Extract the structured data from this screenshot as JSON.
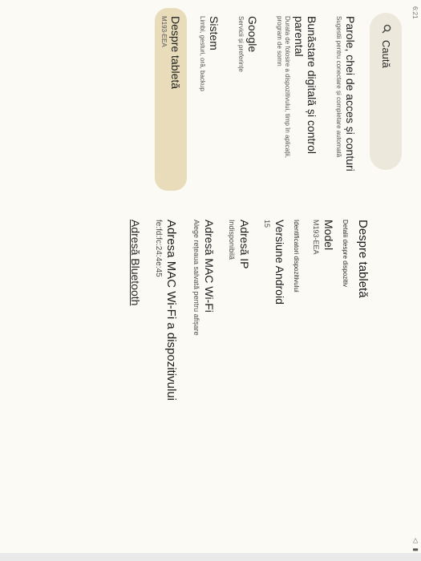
{
  "status": {
    "clock": "6:21",
    "icons": "◁ ▮"
  },
  "search": {
    "label": "Caută"
  },
  "sidebar": {
    "items": [
      {
        "title": "Parole, chei de acces și conturi",
        "subtitle": "Sugestii pentru conectare și completare automată"
      },
      {
        "title": "Bunăstare digitală și control parental",
        "subtitle": "Durata de folosire a dispozitivului, timp în aplicații, program de somn"
      },
      {
        "title": "Google",
        "subtitle": "Servicii și preferințe"
      },
      {
        "title": "Sistem",
        "subtitle": "Limbi, gesturi, oră, backup"
      },
      {
        "title": "Despre tabletă",
        "subtitle": "M193-EEA"
      }
    ]
  },
  "detail": {
    "title": "Despre tabletă",
    "section1": "Detalii despre dispozitiv",
    "model": {
      "title": "Model",
      "value": "M193-EEA"
    },
    "section2": "Identificatori dispozitivului",
    "android": {
      "title": "Versiune Android",
      "value": "15"
    },
    "ip": {
      "title": "Adresă IP",
      "value": "Indisponibilă"
    },
    "mac": {
      "title": "Adresă MAC Wi-Fi",
      "value": "Alege rețeaua salvată pentru afișare"
    },
    "device_mac": {
      "title": "Adresa MAC Wi-Fi a dispozitivului",
      "value": "fe:fd:fc:24:4e:45"
    },
    "bluetooth": {
      "title": "Adresă Bluetooth"
    }
  }
}
